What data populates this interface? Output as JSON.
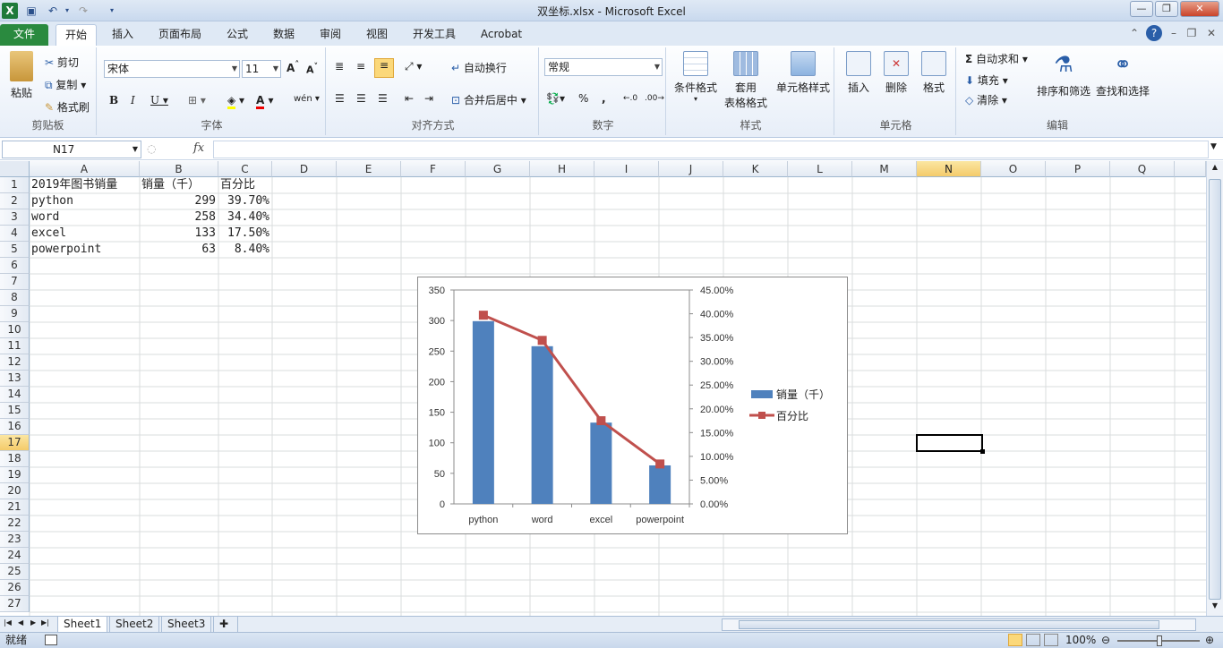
{
  "window": {
    "title": "双坐标.xlsx - Microsoft Excel"
  },
  "tabs": [
    "文件",
    "开始",
    "插入",
    "页面布局",
    "公式",
    "数据",
    "审阅",
    "视图",
    "开发工具",
    "Acrobat"
  ],
  "ribbon": {
    "clipboard": {
      "paste": "粘贴",
      "cut": "剪切",
      "copy": "复制",
      "painter": "格式刷",
      "label": "剪贴板"
    },
    "font": {
      "name": "宋体",
      "size": "11",
      "label": "字体"
    },
    "align": {
      "wrap": "自动换行",
      "merge": "合并后居中",
      "label": "对齐方式"
    },
    "number": {
      "format": "常规",
      "label": "数字",
      "pct": "%",
      "comma": ","
    },
    "styles": {
      "cond": "条件格式",
      "table1": "套用",
      "table2": "表格格式",
      "cellstyle": "单元格样式",
      "label": "样式"
    },
    "cells": {
      "insert": "插入",
      "delete": "删除",
      "format": "格式",
      "label": "单元格"
    },
    "edit": {
      "autosum": "自动求和",
      "fill": "填充",
      "clear": "清除",
      "sort": "排序和筛选",
      "find": "查找和选择",
      "label": "编辑"
    }
  },
  "namebox": "N17",
  "fx": "fx",
  "columns": [
    "A",
    "B",
    "C",
    "D",
    "E",
    "F",
    "G",
    "H",
    "I",
    "J",
    "K",
    "L",
    "M",
    "N",
    "O",
    "P",
    "Q"
  ],
  "rows": [
    "1",
    "2",
    "3",
    "4",
    "5",
    "6",
    "7",
    "8",
    "9",
    "10",
    "11",
    "12",
    "13",
    "14",
    "15",
    "16",
    "17",
    "18",
    "19",
    "20",
    "21",
    "22",
    "23",
    "24",
    "25",
    "26",
    "27"
  ],
  "cells": {
    "A1": "2019年图书销量",
    "B1": "销量（千）",
    "C1": "百分比",
    "A2": "python",
    "B2": "299",
    "C2": "39.70%",
    "A3": "word",
    "B3": "258",
    "C3": "34.40%",
    "A4": "excel",
    "B4": "133",
    "C4": "17.50%",
    "A5": "powerpoint",
    "B5": "63",
    "C5": "8.40%"
  },
  "chart_data": {
    "type": "bar",
    "categories": [
      "python",
      "word",
      "excel",
      "powerpoint"
    ],
    "series": [
      {
        "name": "销量（千）",
        "type": "bar",
        "axis": "left",
        "values": [
          299,
          258,
          133,
          63
        ],
        "color": "#4f81bd"
      },
      {
        "name": "百分比",
        "type": "line",
        "axis": "right",
        "values": [
          39.7,
          34.4,
          17.5,
          8.4
        ],
        "color": "#c0504d"
      }
    ],
    "ylim": [
      0,
      350
    ],
    "yticks": [
      "0",
      "50",
      "100",
      "150",
      "200",
      "250",
      "300",
      "350"
    ],
    "y2lim": [
      0,
      45
    ],
    "y2ticks": [
      "0.00%",
      "5.00%",
      "10.00%",
      "15.00%",
      "20.00%",
      "25.00%",
      "30.00%",
      "35.00%",
      "40.00%",
      "45.00%"
    ],
    "legend": "right",
    "grid": false
  },
  "sheets": [
    "Sheet1",
    "Sheet2",
    "Sheet3"
  ],
  "status": {
    "ready": "就绪",
    "zoom": "100%"
  },
  "colors": {
    "accent": "#2a8a3f",
    "selectedHeader": "#f4cb6a"
  }
}
